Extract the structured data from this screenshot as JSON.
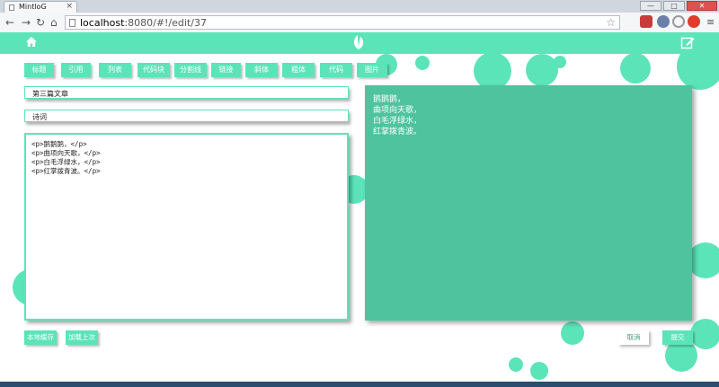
{
  "browser": {
    "tab_title": "MintloG",
    "tab_close": "×",
    "url_host": "localhost",
    "url_path": ":8080/#!/edit/37",
    "window_buttons": [
      "—",
      "□",
      "✕"
    ]
  },
  "app": {
    "accent_color": "#5ce4b9",
    "preview_color": "#4fc39d",
    "icons": {
      "left": "home-icon",
      "center": "leaf-logo-icon",
      "right": "edit-icon"
    }
  },
  "toolbar": {
    "buttons": [
      "标题",
      "引用",
      "列表",
      "代码块",
      "分割线",
      "链接",
      "斜体",
      "粗体",
      "代码",
      "图片"
    ]
  },
  "form": {
    "title_value": "第三篇文章",
    "category_value": "诗词",
    "content_lines": [
      "<p>鹅鹅鹅，</p>",
      "<p>曲项向天歌，</p>",
      "<p>白毛浮绿水，</p>",
      "<p>红掌拨青波。</p>"
    ]
  },
  "preview": {
    "lines": [
      "鹅鹅鹅，",
      "曲项向天歌，",
      "白毛浮绿水，",
      "红掌拨青波。"
    ]
  },
  "actions": {
    "save_local": "本地缓存",
    "load_last": "加载上次",
    "cancel": "取消",
    "submit": "提交"
  }
}
